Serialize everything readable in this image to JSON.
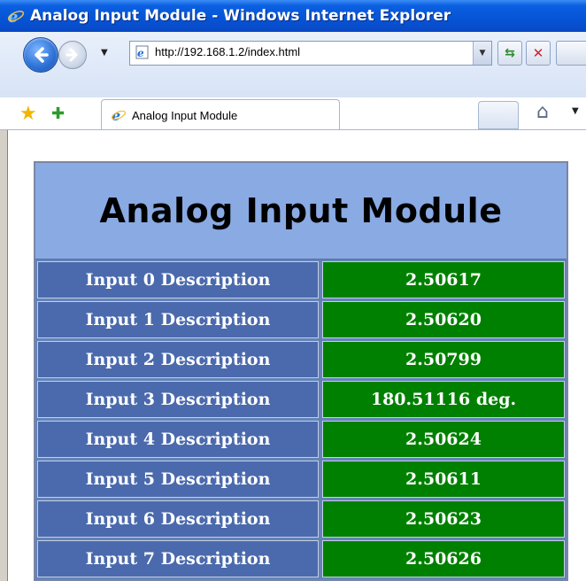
{
  "window": {
    "title": "Analog Input Module - Windows Internet Explorer"
  },
  "address_bar": {
    "url": "http://192.168.1.2/index.html"
  },
  "tab": {
    "label": "Analog Input Module"
  },
  "page": {
    "heading": "Analog Input Module",
    "inputs": [
      {
        "label": "Input 0 Description",
        "value": "2.50617"
      },
      {
        "label": "Input 1 Description",
        "value": "2.50620"
      },
      {
        "label": "Input 2 Description",
        "value": "2.50799"
      },
      {
        "label": "Input 3 Description",
        "value": "180.51116 deg."
      },
      {
        "label": "Input 4 Description",
        "value": "2.50624"
      },
      {
        "label": "Input 5 Description",
        "value": "2.50611"
      },
      {
        "label": "Input 6 Description",
        "value": "2.50623"
      },
      {
        "label": "Input 7 Description",
        "value": "2.50626"
      }
    ]
  },
  "icons": {
    "back": "back-arrow-icon",
    "forward": "forward-arrow-icon",
    "refresh": "refresh-icon",
    "stop": "stop-icon",
    "favorites": "favorites-star-icon",
    "add_favorite": "add-favorite-icon",
    "home": "home-icon",
    "ie": "ie-logo-icon"
  },
  "colors": {
    "header_bg": "#8aaae4",
    "label_bg": "#4b6aad",
    "value_bg": "#008000"
  }
}
